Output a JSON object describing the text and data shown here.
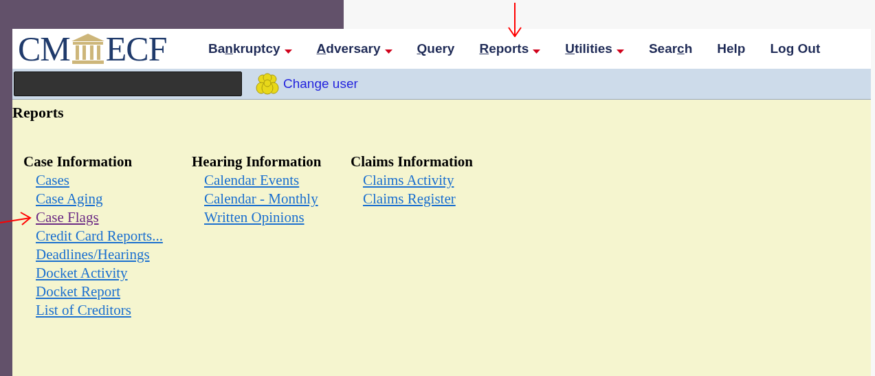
{
  "logo": {
    "left": "CM",
    "right": "ECF"
  },
  "menu": [
    {
      "before": "Ba",
      "key": "n",
      "after": "kruptcy",
      "dropdown": true
    },
    {
      "key": "A",
      "after": "dversary",
      "dropdown": true
    },
    {
      "key": "Q",
      "after": "uery",
      "dropdown": false
    },
    {
      "key": "R",
      "after": "eports",
      "dropdown": true
    },
    {
      "key": "U",
      "after": "tilities",
      "dropdown": true
    },
    {
      "before": "Sear",
      "key": "c",
      "after": "h",
      "dropdown": false
    },
    {
      "before": "Help",
      "dropdown": false
    },
    {
      "before": "Log Out",
      "dropdown": false
    }
  ],
  "user_bar": {
    "change_user": "Change user"
  },
  "page": {
    "title": "Reports",
    "columns": [
      {
        "heading": "Case Information",
        "links": [
          {
            "label": "Cases",
            "visited": false
          },
          {
            "label": "Case Aging",
            "visited": false
          },
          {
            "label": "Case Flags",
            "visited": true
          },
          {
            "label": "Credit Card Reports...",
            "visited": false
          },
          {
            "label": "Deadlines/Hearings",
            "visited": false
          },
          {
            "label": "Docket Activity",
            "visited": false
          },
          {
            "label": "Docket Report",
            "visited": false
          },
          {
            "label": "List of Creditors",
            "visited": false
          }
        ]
      },
      {
        "heading": "Hearing Information",
        "links": [
          {
            "label": "Calendar Events",
            "visited": false
          },
          {
            "label": "Calendar - Monthly",
            "visited": false
          },
          {
            "label": "Written Opinions",
            "visited": false
          }
        ]
      },
      {
        "heading": "Claims Information",
        "links": [
          {
            "label": "Claims Activity",
            "visited": false
          },
          {
            "label": "Claims Register",
            "visited": false
          }
        ]
      }
    ]
  }
}
